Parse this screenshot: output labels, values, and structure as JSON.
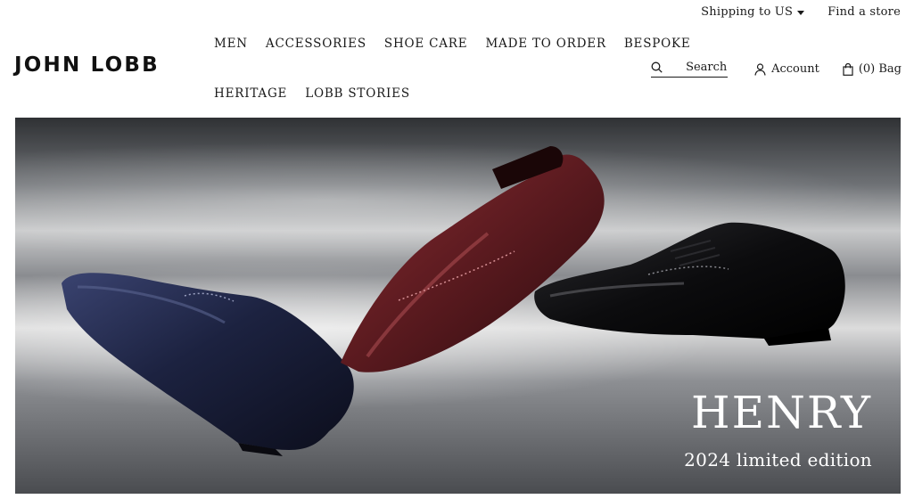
{
  "brand": {
    "logo_text": "JOHN LOBB"
  },
  "topbar": {
    "shipping_label": "Shipping to US",
    "find_store_label": "Find a store"
  },
  "nav": {
    "row1": [
      "MEN",
      "ACCESSORIES",
      "SHOE CARE",
      "MADE TO ORDER",
      "BESPOKE"
    ],
    "row2": [
      "HERITAGE",
      "LOBB STORIES"
    ]
  },
  "utility": {
    "search_label": "Search",
    "account_label": "Account",
    "bag_label": "(0) Bag"
  },
  "hero": {
    "title": "HENRY",
    "subtitle": "2024 limited edition"
  },
  "colors": {
    "text": "#1a1a1a",
    "shoe_navy": "#1c2240",
    "shoe_burgundy": "#5a1a1f",
    "shoe_black": "#0c0c0e",
    "hero_text": "#ffffff"
  }
}
